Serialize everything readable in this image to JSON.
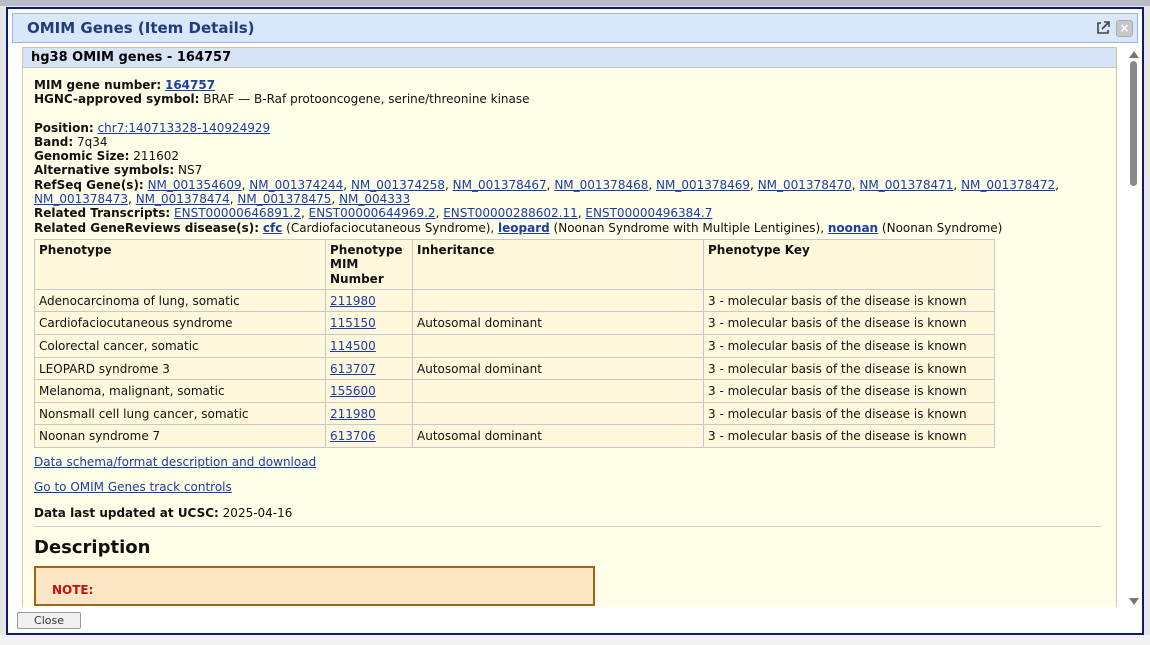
{
  "dialog": {
    "title": "OMIM Genes (Item Details)",
    "close_label": "Close",
    "close_glyph": "×"
  },
  "item": {
    "heading": "hg38 OMIM genes - 164757",
    "mim_label": "MIM gene number:",
    "mim_value": "164757",
    "hgnc_label": "HGNC-approved symbol:",
    "hgnc_value": "BRAF — B-Raf protooncogene, serine/threonine kinase",
    "position_label": "Position:",
    "position_value": "chr7:140713328-140924929",
    "band_label": "Band:",
    "band_value": "7q34",
    "genomic_size_label": "Genomic Size:",
    "genomic_size_value": "211602",
    "alt_symbols_label": "Alternative symbols:",
    "alt_symbols_value": "NS7",
    "refseq_label": "RefSeq Gene(s):",
    "refseq_line1": [
      "NM_001354609",
      "NM_001374244",
      "NM_001374258",
      "NM_001378467",
      "NM_001378468",
      "NM_001378469",
      "NM_001378470",
      "NM_001378471",
      "NM_001378472"
    ],
    "refseq_line2": [
      "NM_001378473",
      "NM_001378474",
      "NM_001378475",
      "NM_004333"
    ],
    "transcripts_label": "Related Transcripts:",
    "transcripts": [
      "ENST00000646891.2",
      "ENST00000644969.2",
      "ENST00000288602.11",
      "ENST00000496384.7"
    ],
    "genereviews_label": "Related GeneReviews disease(s):",
    "genereviews": [
      {
        "code": "cfc",
        "desc": "(Cardiofaciocutaneous Syndrome),"
      },
      {
        "code": "leopard",
        "desc": "(Noonan Syndrome with Multiple Lentigines),"
      },
      {
        "code": "noonan",
        "desc": "(Noonan Syndrome)"
      }
    ]
  },
  "table": {
    "headers": [
      "Phenotype",
      "Phenotype MIM Number",
      "Inheritance",
      "Phenotype Key"
    ],
    "rows": [
      {
        "phenotype": "Adenocarcinoma of lung, somatic",
        "mim": "211980",
        "inheritance": "",
        "key": "3 - molecular basis of the disease is known"
      },
      {
        "phenotype": "Cardiofaciocutaneous syndrome",
        "mim": "115150",
        "inheritance": "Autosomal dominant",
        "key": "3 - molecular basis of the disease is known"
      },
      {
        "phenotype": "Colorectal cancer, somatic",
        "mim": "114500",
        "inheritance": "",
        "key": "3 - molecular basis of the disease is known"
      },
      {
        "phenotype": "LEOPARD syndrome 3",
        "mim": "613707",
        "inheritance": "Autosomal dominant",
        "key": "3 - molecular basis of the disease is known"
      },
      {
        "phenotype": "Melanoma, malignant, somatic",
        "mim": "155600",
        "inheritance": "",
        "key": "3 - molecular basis of the disease is known"
      },
      {
        "phenotype": "Nonsmall cell lung cancer, somatic",
        "mim": "211980",
        "inheritance": "",
        "key": "3 - molecular basis of the disease is known"
      },
      {
        "phenotype": "Noonan syndrome 7",
        "mim": "613706",
        "inheritance": "Autosomal dominant",
        "key": "3 - molecular basis of the disease is known"
      }
    ]
  },
  "links": {
    "schema": "Data schema/format description and download",
    "track_controls": "Go to OMIM Genes track controls"
  },
  "updated": {
    "label": "Data last updated at UCSC:",
    "value": "2025-04-16"
  },
  "description": {
    "heading": "Description",
    "note": "NOTE:"
  },
  "icons": {
    "popout": "external-link-icon",
    "close": "close-icon",
    "scroll_up": "scroll-up-arrow-icon",
    "scroll_down": "scroll-down-arrow-icon"
  },
  "colors": {
    "dialog_border": "#0c1a78",
    "titlebar_bg": "#d9e7fb",
    "title_text": "#1f3d7a",
    "content_bg": "#fffee8",
    "link": "#1a3da8",
    "note_text": "#c01010",
    "note_bg": "#fde6c6"
  }
}
